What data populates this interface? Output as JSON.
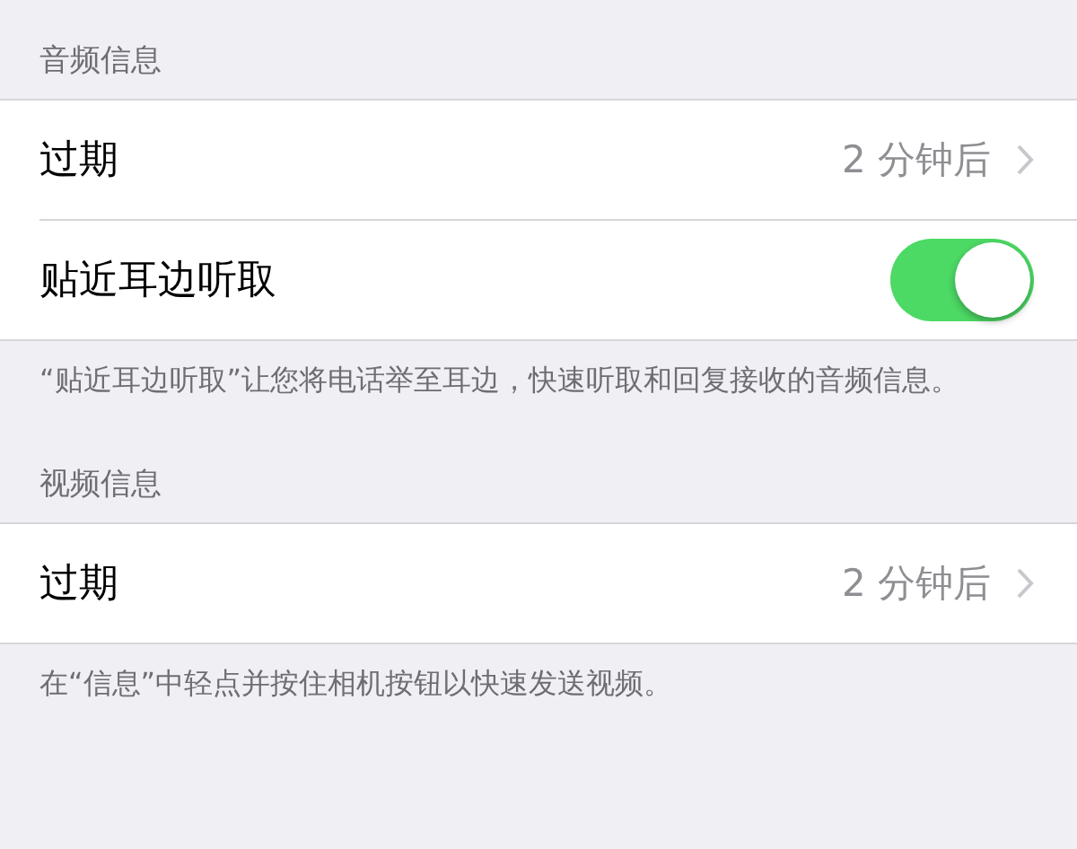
{
  "sections": [
    {
      "header": "音频信息",
      "rows": [
        {
          "kind": "detail",
          "label": "过期",
          "value": "2 分钟后"
        },
        {
          "kind": "toggle",
          "label": "贴近耳边听取",
          "on": true
        }
      ],
      "footer": "“贴近耳边听取”让您将电话举至耳边，快速听取和回复接收的音频信息。"
    },
    {
      "header": "视频信息",
      "rows": [
        {
          "kind": "detail",
          "label": "过期",
          "value": "2 分钟后"
        }
      ],
      "footer": "在“信息”中轻点并按住相机按钮以快速发送视频。"
    }
  ]
}
